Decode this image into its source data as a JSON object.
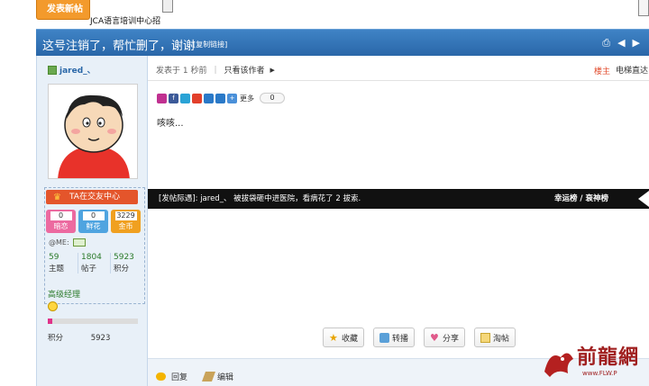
{
  "top": {
    "new_post_label": "发表新帖",
    "promo_text": "JCA语言培训中心招"
  },
  "title_bar": {
    "title": "这号注销了，帮忙删了，谢谢",
    "copy_link": "[复制链接]"
  },
  "user": {
    "username": "jared_、",
    "friend_center": "TA在交友中心",
    "cards": [
      {
        "value": "0",
        "label": "暗恋"
      },
      {
        "value": "0",
        "label": "鲜花"
      },
      {
        "value": "3229",
        "label": "金币"
      }
    ],
    "atme_label": "@ME:",
    "stats": [
      {
        "value": "59",
        "label": "主题"
      },
      {
        "value": "1804",
        "label": "帖子"
      },
      {
        "value": "5923",
        "label": "积分"
      }
    ],
    "rank": "高级经理",
    "progress": 0.05,
    "points_label": "积分",
    "points_value": "5923"
  },
  "post": {
    "posted_at": "发表于 1 秒前",
    "only_author": "只看该作者",
    "floor": "楼主",
    "direct_link": "电梯直达",
    "share_more": "更多",
    "share_count": "0",
    "body": "咳咳..."
  },
  "banner": {
    "text": "[发帖际遇]: jared_、 被拔袋砸中进医院，看病花了 2 拔索.",
    "links": "幸运榜 / 衰神榜"
  },
  "actions": [
    {
      "label": "收藏",
      "icon": "star-icon"
    },
    {
      "label": "转播",
      "icon": "broadcast-icon"
    },
    {
      "label": "分享",
      "icon": "heart-icon"
    },
    {
      "label": "淘帖",
      "icon": "folder-icon"
    }
  ],
  "footer": {
    "reply": "回复",
    "edit": "编辑"
  },
  "watermark": {
    "text": "前龍網",
    "url": "www.FLW.P"
  },
  "colors": {
    "title_bar": "#2f6fb2",
    "sidebar_bg": "#e8f0f8",
    "banner_bg": "#111111",
    "accent_orange": "#f39a2c"
  }
}
